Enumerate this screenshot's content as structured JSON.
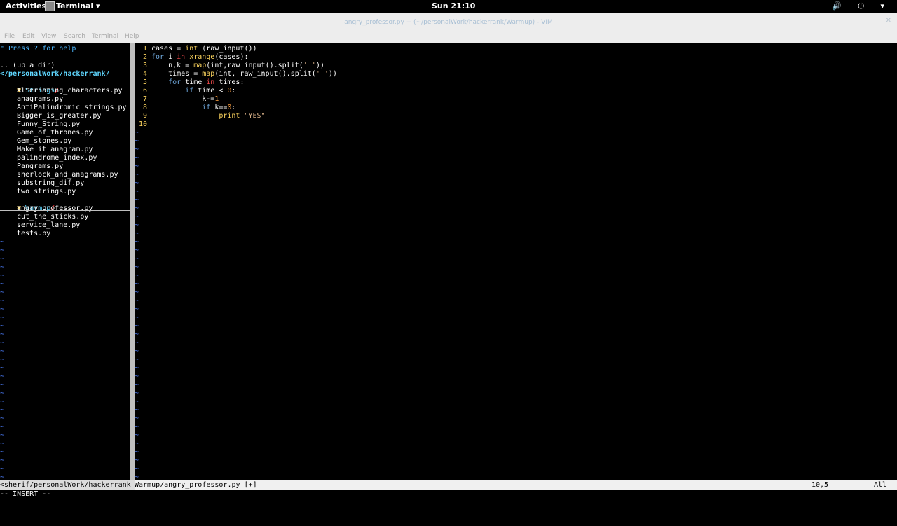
{
  "topbar": {
    "activities": "Activities",
    "app_menu": "Terminal ▾",
    "clock": "Sun 21:10",
    "system_icons": "🔊 ⏻ ▾"
  },
  "window": {
    "title": "angry_professor.py + (~/personalWork/hackerrank/Warmup) - VIM",
    "close_glyph": "✕"
  },
  "menu": [
    "File",
    "Edit",
    "View",
    "Search",
    "Terminal",
    "Help"
  ],
  "nerdtree": {
    "help": "\" Press ? for help",
    "up_dir": ".. (up a dir)",
    "root": "</personalWork/hackerrank/",
    "folders": [
      {
        "name": "Strings",
        "files": [
          "Alternating_characters.py",
          "anagrams.py",
          "AntiPalindromic_strings.py",
          "Bigger_is_greater.py",
          "Funny_String.py",
          "Game_of_thrones.py",
          "Gem_stones.py",
          "Make_it_anagram.py",
          "palindrome_index.py",
          "Pangrams.py",
          "sherlock_and_anagrams.py",
          "substring_dif.py",
          "two_strings.py"
        ]
      },
      {
        "name": "Warmup",
        "files": [
          "angry_professor.py",
          "cut_the_sticks.py",
          "service_lane.py",
          "tests.py"
        ]
      }
    ]
  },
  "editor": {
    "line_numbers": [
      "1",
      "2",
      "3",
      "4",
      "5",
      "6",
      "7",
      "8",
      "9",
      "10"
    ],
    "code": {
      "l1_a": "cases = ",
      "l1_b": "int",
      "l1_c": " (raw_input())",
      "l2_a": "for",
      "l2_b": " i ",
      "l2_c": "in",
      "l2_d": " xrange",
      "l2_e": "(cases):",
      "l3_a": "    n,k = ",
      "l3_b": "map",
      "l3_c": "(int,raw_input().split(",
      "l3_d": "' '",
      "l3_e": "))",
      "l4_a": "    times = ",
      "l4_b": "map",
      "l4_c": "(int, raw_input().split(",
      "l4_d": "' '",
      "l4_e": "))",
      "l5_a": "    ",
      "l5_b": "for",
      "l5_c": " time ",
      "l5_d": "in",
      "l5_e": " times:",
      "l6_a": "        ",
      "l6_b": "if",
      "l6_c": " time < ",
      "l6_d": "0",
      "l6_e": ":",
      "l7_a": "            k-=",
      "l7_b": "1",
      "l8_a": "            ",
      "l8_b": "if",
      "l8_c": " k==",
      "l8_d": "0",
      "l8_e": ":",
      "l9_a": "                ",
      "l9_b": "print",
      "l9_c": " ",
      "l9_d": "\"YES\""
    },
    "tilde": "~"
  },
  "status": {
    "left": "<sherif/personalWork/hackerrank ",
    "file": "Warmup/angry_professor.py [+]",
    "position": "10,5",
    "scroll": "All"
  },
  "mode": "-- INSERT --"
}
